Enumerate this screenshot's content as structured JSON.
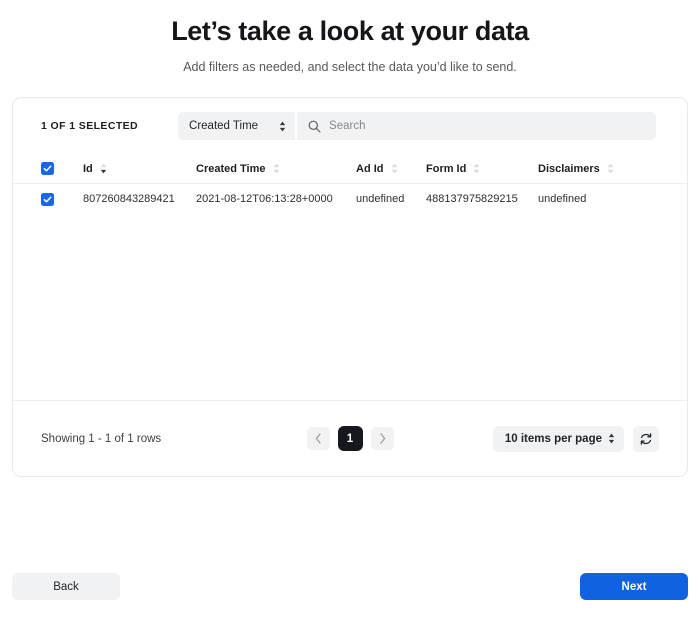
{
  "header": {
    "title": "Let’s take a look at your data",
    "subtitle": "Add filters as needed, and select the data you’d like to send."
  },
  "toolbar": {
    "selected_count": "1 OF 1 SELECTED",
    "filter_field": "Created Time",
    "search_placeholder": "Search",
    "search_value": ""
  },
  "table": {
    "columns": [
      {
        "label": "Id",
        "sort": "desc"
      },
      {
        "label": "Created Time",
        "sort": "none"
      },
      {
        "label": "Ad Id",
        "sort": "none"
      },
      {
        "label": "Form Id",
        "sort": "none"
      },
      {
        "label": "Disclaimers",
        "sort": "none"
      }
    ],
    "rows": [
      {
        "selected": true,
        "id": "807260843289421",
        "created_time": "2021-08-12T06:13:28+0000",
        "ad_id": "undefined",
        "form_id": "488137975829215",
        "disclaimers": "undefined"
      }
    ],
    "select_all_checked": true
  },
  "footer": {
    "showing": "Showing 1 - 1 of 1 rows",
    "page_current": "1",
    "per_page": "10 items per page"
  },
  "nav": {
    "back_label": "Back",
    "next_label": "Next"
  },
  "colors": {
    "accent": "#1162e0",
    "checkbox": "#1a66e8",
    "control_bg": "#f1f2f3",
    "page_active": "#15181c"
  }
}
